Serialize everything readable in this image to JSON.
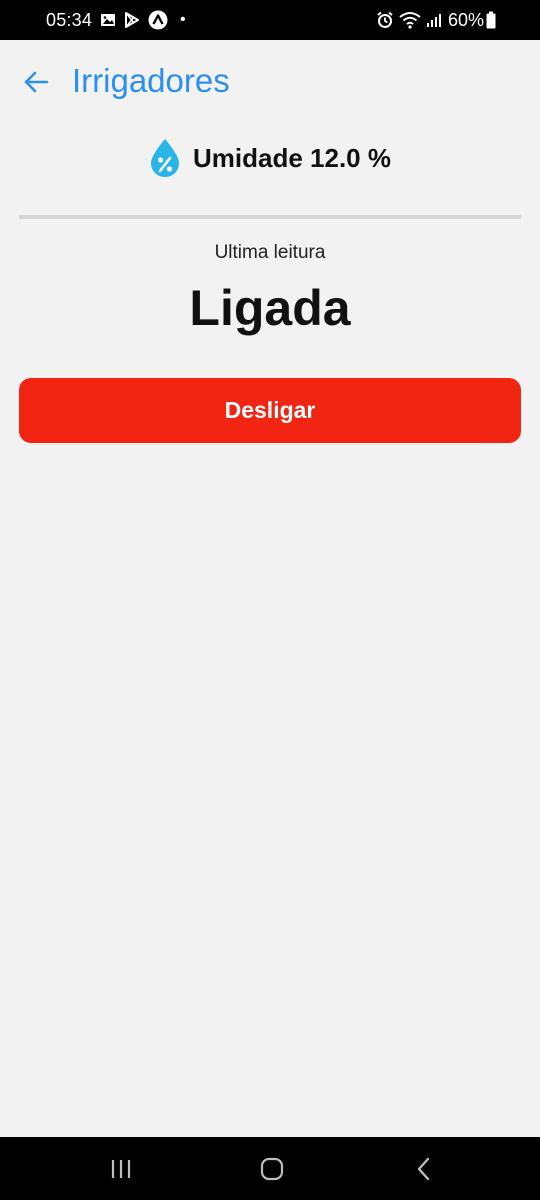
{
  "status_bar": {
    "time": "05:34",
    "dot": "•",
    "battery_text": "60%",
    "left_icons": [
      "gallery-icon",
      "play-store-icon",
      "app-icon"
    ],
    "right_icons": [
      "alarm-icon",
      "wifi-icon",
      "signal-icon",
      "battery-icon"
    ]
  },
  "app_bar": {
    "title": "Irrigadores",
    "back_icon": "arrow-left-icon"
  },
  "humidity": {
    "icon": "water-drop-percent-icon",
    "text": "Umidade 12.0 %"
  },
  "reading": {
    "label": "Ultima leitura",
    "value": "Ligada"
  },
  "action": {
    "label": "Desligar"
  },
  "nav": {
    "recents_icon": "recents-icon",
    "home_icon": "home-icon",
    "back_icon": "back-icon"
  },
  "colors": {
    "accent": "#2d8ff0",
    "button": "#f22412",
    "drop": "#29b6e6",
    "background": "#f2f2f2"
  }
}
